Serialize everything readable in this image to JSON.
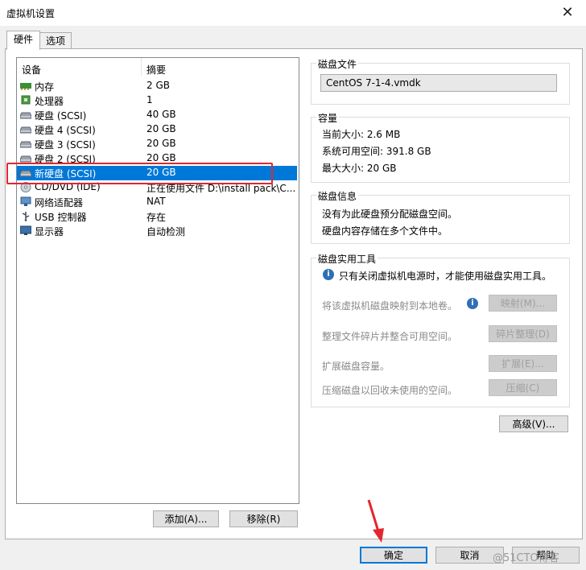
{
  "window": {
    "title": "虚拟机设置",
    "close_label": "✕"
  },
  "tabs": [
    {
      "label": "硬件"
    },
    {
      "label": "选项"
    }
  ],
  "device_list": {
    "col_device": "设备",
    "col_summary": "摘要",
    "rows": [
      {
        "name": "内存",
        "summary": "2 GB",
        "icon": "memory-icon"
      },
      {
        "name": "处理器",
        "summary": "1",
        "icon": "cpu-icon"
      },
      {
        "name": "硬盘 (SCSI)",
        "summary": "40 GB",
        "icon": "disk-icon"
      },
      {
        "name": "硬盘 4 (SCSI)",
        "summary": "20 GB",
        "icon": "disk-icon"
      },
      {
        "name": "硬盘 3 (SCSI)",
        "summary": "20 GB",
        "icon": "disk-icon"
      },
      {
        "name": "硬盘 2 (SCSI)",
        "summary": "20 GB",
        "icon": "disk-icon"
      },
      {
        "name": "新硬盘 (SCSI)",
        "summary": "20 GB",
        "icon": "disk-icon"
      },
      {
        "name": "CD/DVD (IDE)",
        "summary": "正在使用文件 D:\\install pack\\C...",
        "icon": "cdrom-icon"
      },
      {
        "name": "网络适配器",
        "summary": "NAT",
        "icon": "network-icon"
      },
      {
        "name": "USB 控制器",
        "summary": "存在",
        "icon": "usb-icon"
      },
      {
        "name": "显示器",
        "summary": "自动检测",
        "icon": "monitor-icon"
      }
    ]
  },
  "list_buttons": {
    "add": "添加(A)...",
    "remove": "移除(R)"
  },
  "disk_file": {
    "title": "磁盘文件",
    "value": "CentOS 7-1-4.vmdk"
  },
  "capacity": {
    "title": "容量",
    "current": "当前大小: 2.6 MB",
    "available": "系统可用空间: 391.8 GB",
    "max": "最大大小: 20 GB"
  },
  "disk_info": {
    "title": "磁盘信息",
    "line1": "没有为此硬盘预分配磁盘空间。",
    "line2": "硬盘内容存储在多个文件中。"
  },
  "utilities": {
    "title": "磁盘实用工具",
    "notice": "只有关闭虚拟机电源时，才能使用磁盘实用工具。",
    "map_desc": "将该虚拟机磁盘映射到本地卷。",
    "map_btn": "映射(M)...",
    "defrag_desc": "整理文件碎片并整合可用空间。",
    "defrag_btn": "碎片整理(D)",
    "expand_desc": "扩展磁盘容量。",
    "expand_btn": "扩展(E)...",
    "compact_desc": "压缩磁盘以回收未使用的空间。",
    "compact_btn": "压缩(C)"
  },
  "advanced_btn": "高级(V)...",
  "footer": {
    "ok": "确定",
    "cancel": "取消",
    "help": "帮助"
  },
  "watermark": "@51CTO博客",
  "colors": {
    "selection": "#0078d7",
    "highlight_box": "#e3262e",
    "arrow": "#e3262e"
  }
}
